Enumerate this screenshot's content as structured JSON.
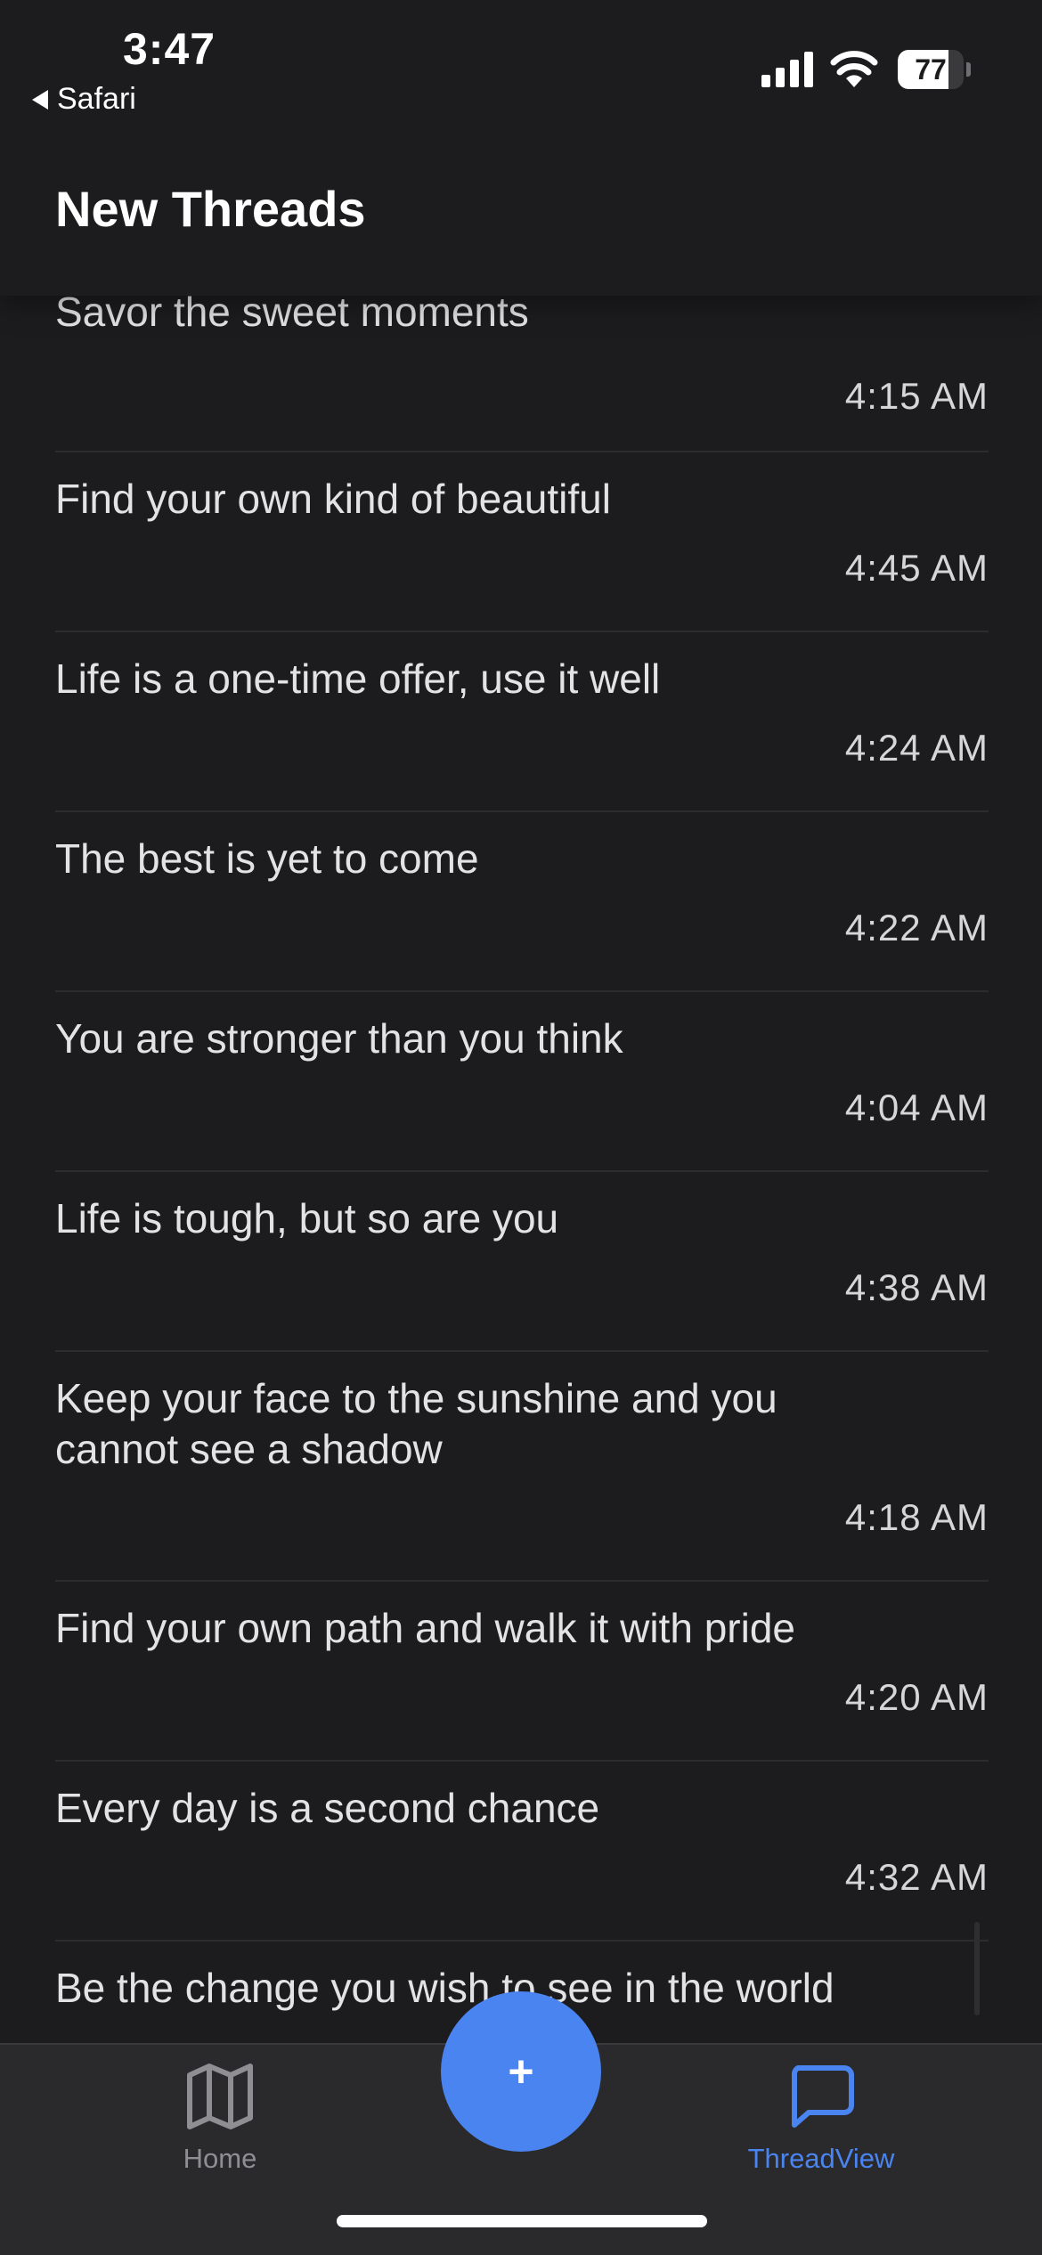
{
  "status_bar": {
    "time": "3:47",
    "back_label": "Safari",
    "battery_level": "77",
    "battery_fraction": 0.77
  },
  "header": {
    "title": "New Threads"
  },
  "threads": [
    {
      "title": "Savor the sweet moments",
      "time": "4:15 AM"
    },
    {
      "title": "Find your own kind of beautiful",
      "time": "4:45 AM"
    },
    {
      "title": "Life is a one-time offer, use it well",
      "time": "4:24 AM"
    },
    {
      "title": "The best is yet to come",
      "time": "4:22 AM"
    },
    {
      "title": "You are stronger than you think",
      "time": "4:04 AM"
    },
    {
      "title": "Life is tough, but so are you",
      "time": "4:38 AM"
    },
    {
      "title": "Keep your face to the sunshine and you cannot see a shadow",
      "time": "4:18 AM"
    },
    {
      "title": "Find your own path and walk it with pride",
      "time": "4:20 AM"
    },
    {
      "title": "Every day is a second chance",
      "time": "4:32 AM"
    },
    {
      "title": "Be the change you wish to see in the world",
      "time": ""
    }
  ],
  "tab_bar": {
    "home_label": "Home",
    "home_icon": "map-icon",
    "thread_label": "ThreadView",
    "thread_icon": "chat-bubble-icon",
    "fab_label": "+",
    "active_tab": "ThreadView",
    "accent_color": "#4a84f0",
    "inactive_color": "#8e8e93"
  }
}
